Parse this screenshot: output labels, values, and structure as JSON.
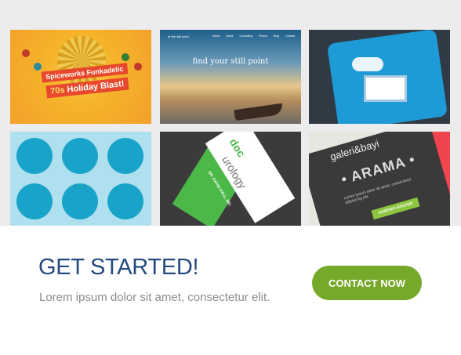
{
  "gallery": {
    "tiles": [
      {
        "label_line1": "Spiceworks Funkadelic",
        "label_line2_a": "70s",
        "label_line2_b": "Holiday Blast!"
      },
      {
        "brand": "at the still point",
        "menu": [
          "Home",
          "About",
          "Consulting",
          "Photos",
          "Blog",
          "Contact"
        ],
        "headline": "find your still point"
      },
      {},
      {},
      {
        "brand_a": "urology",
        "brand_b": "doc",
        "name": "DR. DAVID HALL, MD."
      },
      {
        "title_a": "galeri&bayi",
        "title_b": "• ARAMA •",
        "body": "Lorem ipsum dolor sit amet, consectetur adipiscing elit.",
        "button": "HARİTAYI GÖSTER"
      }
    ]
  },
  "cta": {
    "title": "GET STARTED!",
    "subtitle": "Lorem ipsum dolor sit amet, consectetur elit.",
    "button_label": "CONTACT NOW",
    "colors": {
      "title": "#244b7f",
      "button": "#76a92a"
    }
  }
}
